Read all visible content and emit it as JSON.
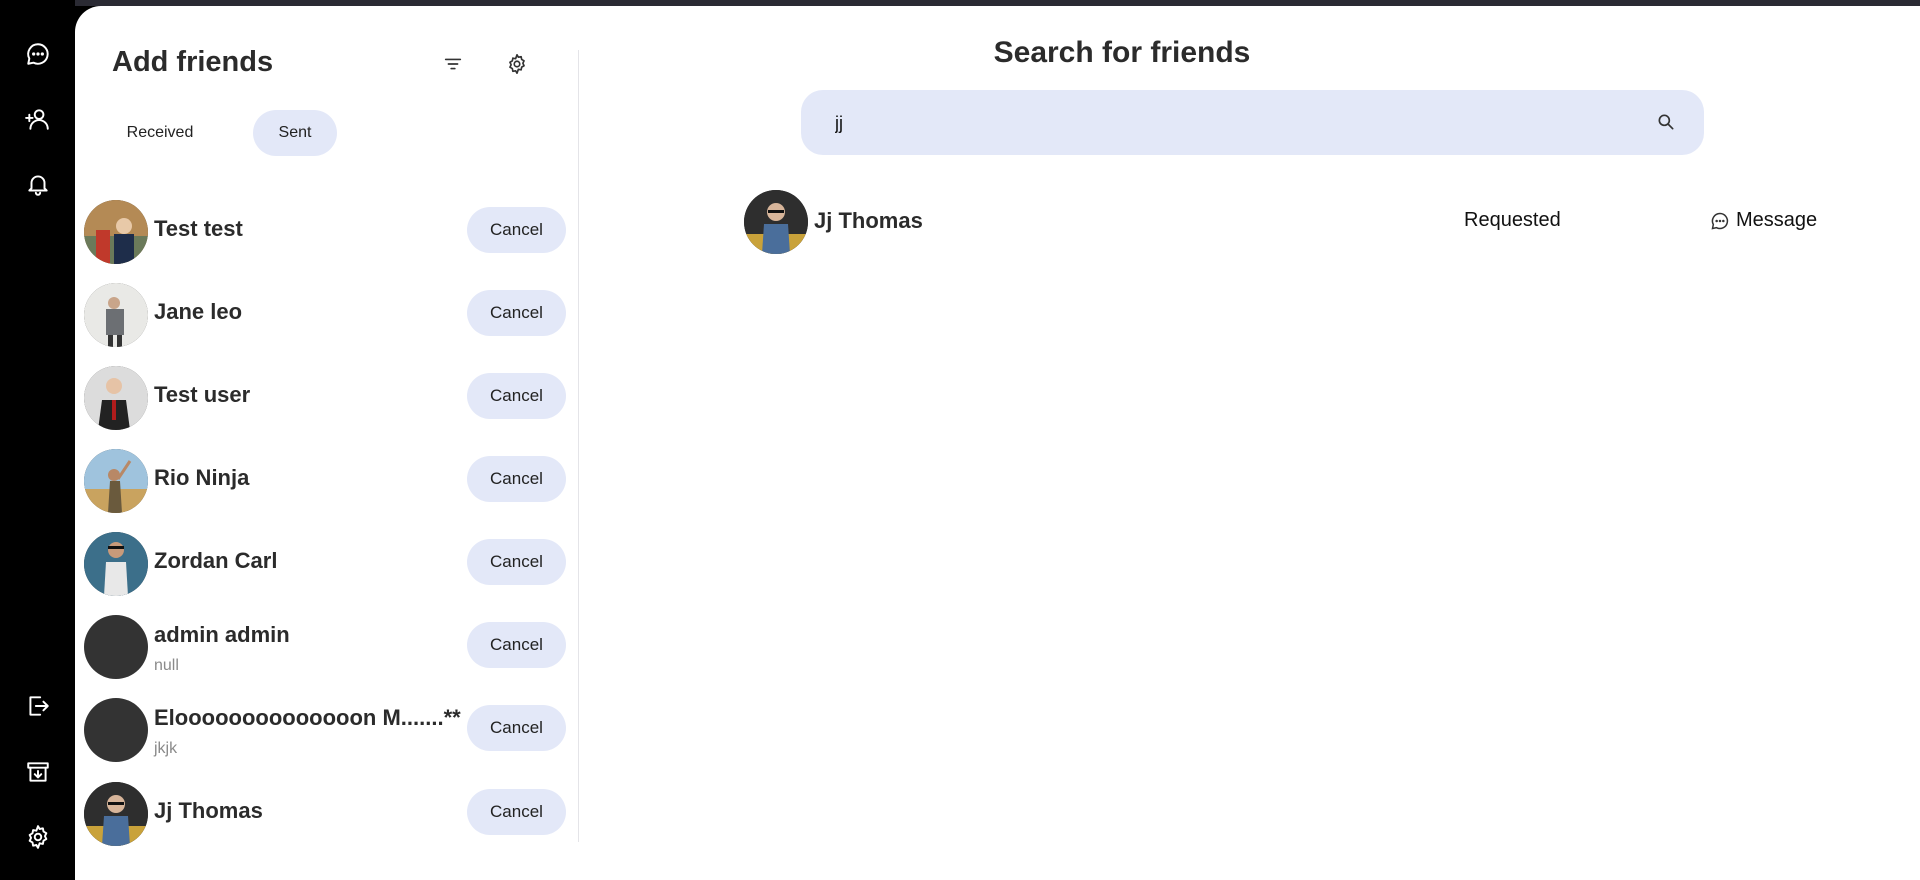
{
  "left_panel": {
    "title": "Add friends",
    "tabs": [
      "Received",
      "Sent"
    ],
    "active_tab": "Sent",
    "friends": [
      {
        "name": "Test test",
        "subtitle": "",
        "action": "Cancel"
      },
      {
        "name": "Jane leo",
        "subtitle": "",
        "action": "Cancel"
      },
      {
        "name": "Test user",
        "subtitle": "",
        "action": "Cancel"
      },
      {
        "name": "Rio Ninja",
        "subtitle": "",
        "action": "Cancel"
      },
      {
        "name": "Zordan Carl",
        "subtitle": "",
        "action": "Cancel"
      },
      {
        "name": "admin admin",
        "subtitle": "null",
        "action": "Cancel"
      },
      {
        "name": "Eloooooooooooooon M.......**",
        "subtitle": "jkjk",
        "action": "Cancel"
      },
      {
        "name": "Jj Thomas",
        "subtitle": "",
        "action": "Cancel"
      }
    ]
  },
  "search": {
    "title": "Search for friends",
    "query": "jj",
    "result": {
      "name": "Jj Thomas",
      "status": "Requested",
      "message_label": "Message"
    }
  },
  "icons": {
    "rail_top": [
      "chat-bubble-icon",
      "add-user-icon",
      "bell-icon"
    ],
    "rail_bottom": [
      "logout-icon",
      "archive-icon",
      "gear-icon"
    ],
    "header": [
      "filter-icon",
      "gear-icon"
    ]
  },
  "colors": {
    "accent_bg": "#e3e8f8",
    "rail": "#000000"
  }
}
